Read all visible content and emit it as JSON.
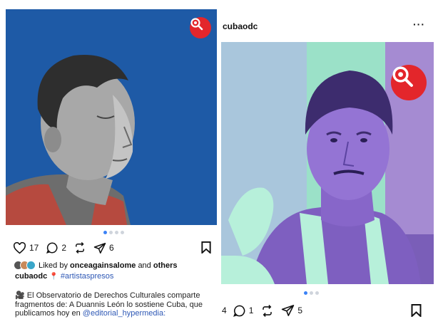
{
  "left_post": {
    "likes": "17",
    "comments": "2",
    "shares": "6",
    "liked_prefix": "Liked by",
    "liked_user": "onceagainsalome",
    "liked_and": "and",
    "liked_others": "others",
    "username": "cubaodc",
    "hashtag": "#artistaspresos",
    "caption_line": "🎥 El Observatorio de Derechos Culturales comparte fragmentos de: A Duannis León lo sostiene Cuba, que publicamos hoy en",
    "mention": "@editorial_hypermedia:"
  },
  "right_post": {
    "username": "cubaodc",
    "more_label": "···",
    "likes": "4",
    "comments": "1",
    "shares": "5"
  },
  "icons": {
    "like": "heart-icon",
    "comment": "comment-icon",
    "repost": "repost-icon",
    "share": "send-icon",
    "save": "bookmark-icon",
    "brand_badge": "magnifier-handcuff-icon"
  },
  "colors": {
    "badge_red": "#e3262b",
    "left_photo_bg": "#1e5aa6",
    "right_photo_tint": "#9be1c8",
    "link_blue": "#2e58b5",
    "dot_active": "#3b82f6"
  }
}
